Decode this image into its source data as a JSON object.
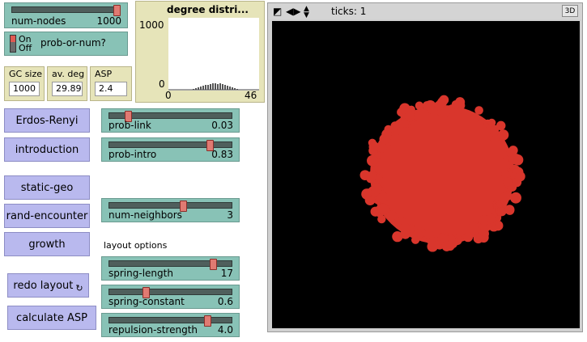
{
  "colors": {
    "slider": "#88c2b6",
    "button": "#b9b9ee",
    "monitor": "#e6e4b9",
    "network": "#d9362c",
    "world_bg": "#000000"
  },
  "sliders": {
    "num_nodes": {
      "label": "num-nodes",
      "value": "1000",
      "position_fraction": 0.97
    },
    "prob_link": {
      "label": "prob-link",
      "value": "0.03",
      "position_fraction": 0.15
    },
    "prob_intro": {
      "label": "prob-intro",
      "value": "0.83",
      "position_fraction": 0.82
    },
    "num_neighbors": {
      "label": "num-neighbors",
      "value": "3",
      "position_fraction": 0.6
    },
    "spring_length": {
      "label": "spring-length",
      "value": "17",
      "position_fraction": 0.85
    },
    "spring_constant": {
      "label": "spring-constant",
      "value": "0.6",
      "position_fraction": 0.3
    },
    "repulsion_strength": {
      "label": "repulsion-strength",
      "value": "4.0",
      "position_fraction": 0.8
    }
  },
  "switch": {
    "name": "prob-or-num?",
    "on_label": "On",
    "off_label": "Off",
    "state": "on"
  },
  "monitors": {
    "gc_size": {
      "label": "GC size",
      "value": "1000"
    },
    "av_deg": {
      "label": "av. deg",
      "value": "29.89"
    },
    "asp": {
      "label": "ASP",
      "value": "2.4"
    }
  },
  "plot": {
    "title": "degree distri...",
    "y_max": "1000",
    "y_min": "0",
    "x_min": "0",
    "x_max": "46"
  },
  "buttons": {
    "erdos_renyi": "Erdos-Renyi",
    "introduction": "introduction",
    "static_geo": "static-geo",
    "rand_encounter": "rand-encounter",
    "growth": "growth",
    "redo_layout": "redo layout",
    "calculate_asp": "calculate ASP"
  },
  "labels": {
    "layout_options": "layout options"
  },
  "view": {
    "ticks_label": "ticks: 1",
    "btn_3d": "3D"
  },
  "icons": {
    "forever": "forever-arrows-icon",
    "speed": "speed-control-icon",
    "arrows_lr": "left-right-arrows-icon",
    "arrows_ud": "up-down-arrows-icon"
  }
}
